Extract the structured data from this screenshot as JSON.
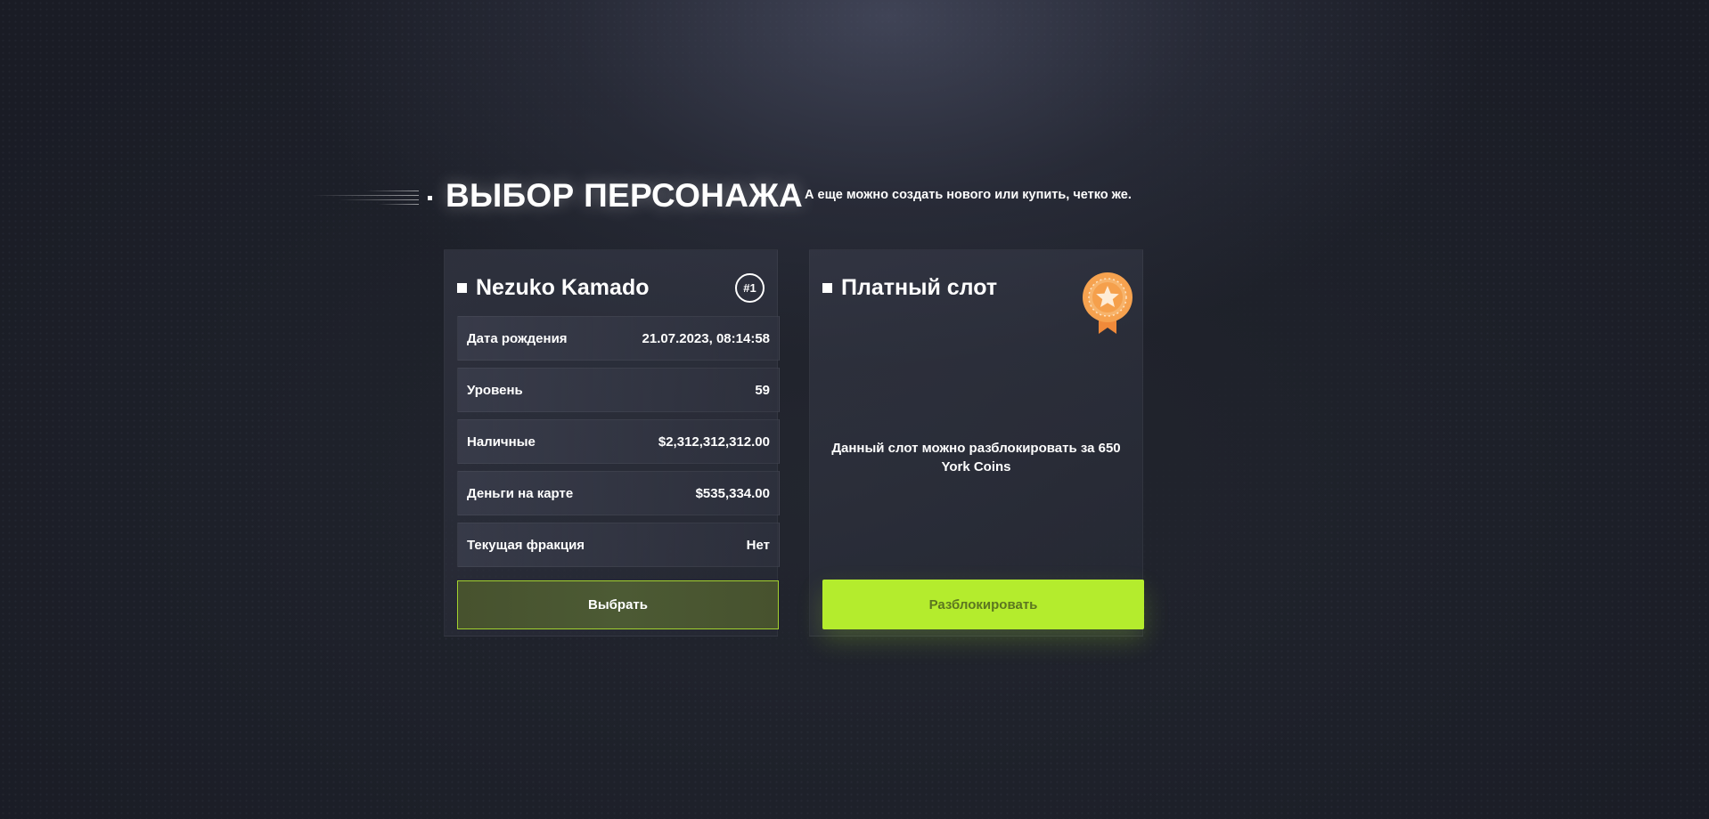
{
  "header": {
    "title": "ВЫБОР ПЕРСОНАЖА",
    "subtitle": "А еще можно создать нового или купить, четко же."
  },
  "character": {
    "name": "Nezuko Kamado",
    "badge": "#1",
    "rows": [
      {
        "label": "Дата рождения",
        "value": "21.07.2023, 08:14:58"
      },
      {
        "label": "Уровень",
        "value": "59"
      },
      {
        "label": "Наличные",
        "value": "$2,312,312,312.00"
      },
      {
        "label": "Деньги на карте",
        "value": "$535,334.00"
      },
      {
        "label": "Текущая фракция",
        "value": "Нет"
      }
    ],
    "select_label": "Выбрать"
  },
  "paid_slot": {
    "title": "Платный слот",
    "icon": "medal-icon",
    "description": "Данный слот можно разблокировать за 650 York Coins",
    "unlock_label": "Разблокировать"
  },
  "colors": {
    "accent": "#b4ec2d",
    "medal": "#f4a24e"
  }
}
